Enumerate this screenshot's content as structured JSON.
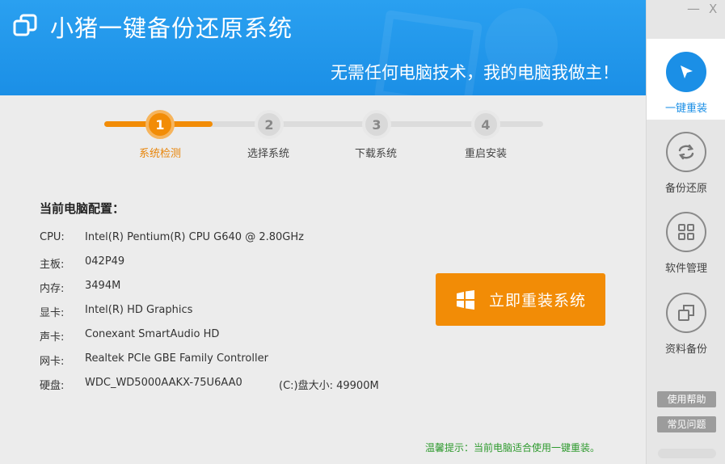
{
  "header": {
    "title": "小猪一键备份还原系统",
    "slogan": "无需任何电脑技术，我的电脑我做主！"
  },
  "window_controls": {
    "minimize": "—",
    "close": "X"
  },
  "sidebar": {
    "items": [
      {
        "label": "一键重装",
        "icon": "cursor-arrow-icon",
        "active": true
      },
      {
        "label": "备份还原",
        "icon": "refresh-arrows-icon",
        "active": false
      },
      {
        "label": "软件管理",
        "icon": "grid-icon",
        "active": false
      },
      {
        "label": "资料备份",
        "icon": "copy-icon",
        "active": false
      }
    ],
    "help_label": "使用帮助",
    "faq_label": "常见问题"
  },
  "steps": [
    {
      "num": "1",
      "label": "系统检测",
      "active": true
    },
    {
      "num": "2",
      "label": "选择系统",
      "active": false
    },
    {
      "num": "3",
      "label": "下载系统",
      "active": false
    },
    {
      "num": "4",
      "label": "重启安装",
      "active": false
    }
  ],
  "config": {
    "title": "当前电脑配置：",
    "rows": [
      {
        "key": "CPU:",
        "value": "Intel(R) Pentium(R) CPU G640 @ 2.80GHz"
      },
      {
        "key": "主板:",
        "value": "042P49"
      },
      {
        "key": "内存:",
        "value": "3494M"
      },
      {
        "key": "显卡:",
        "value": "Intel(R) HD Graphics"
      },
      {
        "key": "声卡:",
        "value": "Conexant SmartAudio HD"
      },
      {
        "key": "网卡:",
        "value": "Realtek PCIe GBE Family Controller"
      },
      {
        "key": "硬盘:",
        "value": "WDC_WD5000AAKX-75U6AA0",
        "extra": "(C:)盘大小: 49900M"
      }
    ]
  },
  "reinstall_button": "立即重装系统",
  "tip": "温馨提示：当前电脑适合使用一键重装。",
  "colors": {
    "header_blue": "#1b8fe6",
    "accent_orange": "#f28c06",
    "tip_green": "#2e9a2e"
  }
}
